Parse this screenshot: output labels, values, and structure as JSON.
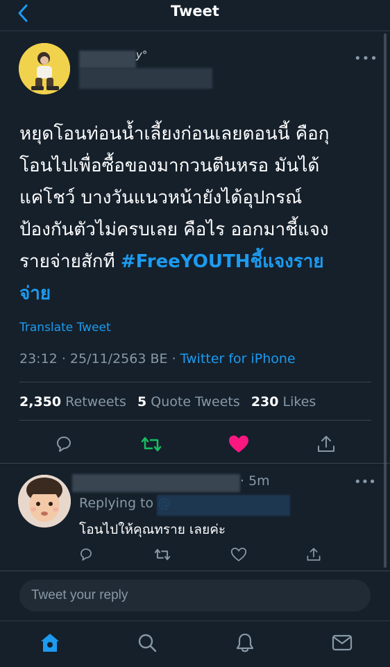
{
  "header": {
    "title": "Tweet",
    "back_icon": "chevron-left-icon"
  },
  "tweet": {
    "name_tail": "y°",
    "text_lines": [
      "หยุดโอนท่อนน้ำเลี้ยงก่อนเลยตอนนี้ คือกุ",
      "โอนไปเพื่อซื้อของมากวนตีนหรอ มันได้",
      "แค่โชว์ บางวันแนวหน้ายังได้อุปกรณ์",
      "ป้องกันตัวไม่ครบเลย คือไร ออกมาชี้แจง",
      "รายจ่ายสักที "
    ],
    "hashtag_line1": "#FreeYOUTHชี้แจงราย",
    "hashtag_line2": "จ่าย",
    "translate": "Translate Tweet",
    "time": "23:12",
    "date": "25/11/2563 BE",
    "separator": "·",
    "source": "Twitter for iPhone",
    "retweets_count": "2,350",
    "retweets_label": "Retweets",
    "quotes_count": "5",
    "quotes_label": "Quote Tweets",
    "likes_count": "230",
    "likes_label": "Likes",
    "liked": true,
    "colors": {
      "accent": "#1d9bf0",
      "retweet": "#17bf63",
      "like": "#f91880",
      "muted": "#8899a6",
      "bg": "#15202b"
    }
  },
  "reply": {
    "time": "· 5m",
    "replying_to": "Replying to",
    "replying_handle": "@",
    "text": "โอนไปให้คุณทราย เลยค่ะ"
  },
  "compose": {
    "placeholder": "Tweet your reply"
  },
  "tabs": [
    "home-icon",
    "search-icon",
    "notifications-icon",
    "messages-icon"
  ]
}
